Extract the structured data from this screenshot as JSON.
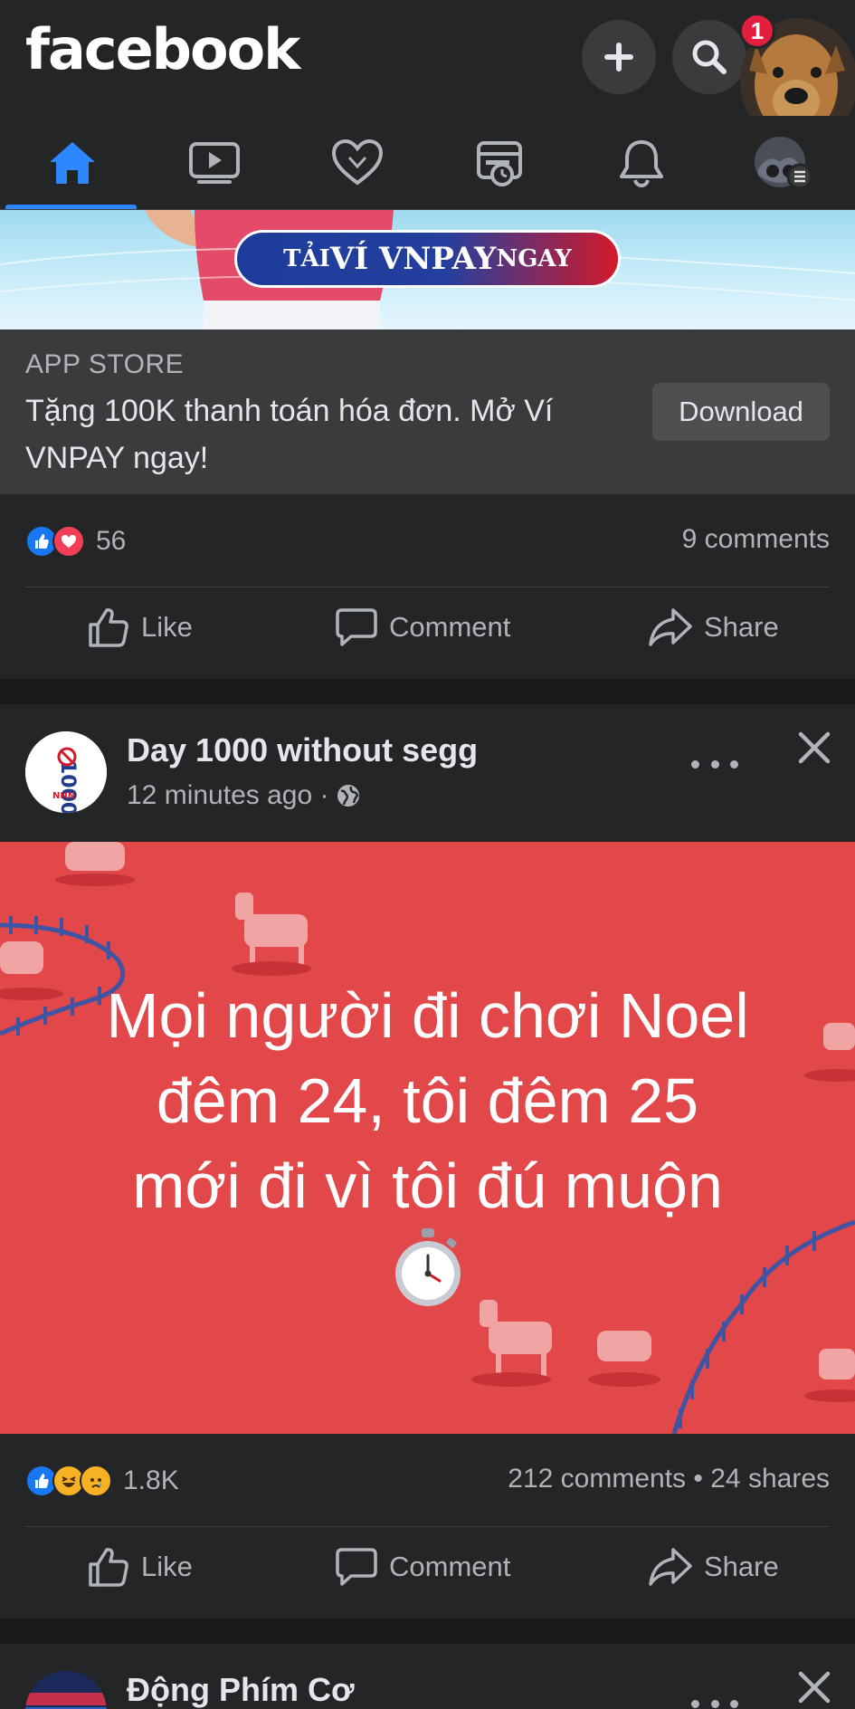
{
  "header": {
    "logo": "facebook",
    "notification_badge": "1",
    "icons": [
      "plus-icon",
      "search-icon"
    ]
  },
  "nav": {
    "tabs": [
      "home-icon",
      "video-icon",
      "dating-heart-icon",
      "marketplace-icon",
      "notifications-bell-icon",
      "profile-menu-icon"
    ],
    "active": "home-icon",
    "accent_color": "#2d88ff"
  },
  "ad_post": {
    "banner_cta": "TẢI VÍ VNPAY NGAY",
    "banner_cta_parts": {
      "p1": "TẢI ",
      "p2": "VÍ VNPAY",
      "p3": " NGAY"
    },
    "source": "APP STORE",
    "headline": "Tặng 100K thanh toán hóa đơn. Mở Ví VNPAY ngay!",
    "download_label": "Download",
    "reaction_count": "56",
    "comments": "9 comments",
    "actions": {
      "like": "Like",
      "comment": "Comment",
      "share": "Share"
    }
  },
  "post": {
    "author": "Day 1000 without segg",
    "time": "12 minutes ago ·",
    "background_color": "#e2474a",
    "text_line1": "Mọi người đi chơi Noel",
    "text_line2": "đêm 24, tôi đêm 25",
    "text_line3": "mới đi vì tôi đú muộn",
    "emoji": "⏱️",
    "reaction_count": "1.8K",
    "comments": "212 comments",
    "shares_sep": " • ",
    "shares": "24 shares",
    "actions": {
      "like": "Like",
      "comment": "Comment",
      "share": "Share"
    }
  },
  "next_post": {
    "author": "Động Phím Cơ"
  }
}
